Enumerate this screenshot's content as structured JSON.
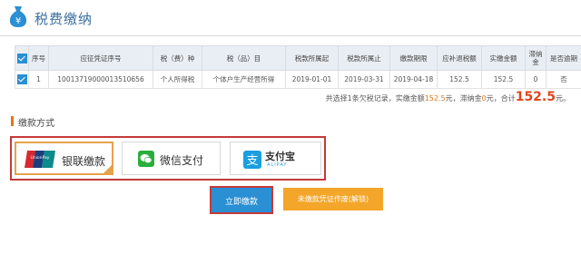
{
  "header": {
    "title": "税费缴纳"
  },
  "table": {
    "columns": [
      "序号",
      "应征凭证序号",
      "税（费）种",
      "税（品）目",
      "税款所属起",
      "税款所属止",
      "缴款期限",
      "应补退税额",
      "实缴金额",
      "滞纳金",
      "是否逾期"
    ],
    "rows": [
      [
        "1",
        "10013719000013510656",
        "个人所得税",
        "个体户生产经营所得",
        "2019-01-01",
        "2019-03-31",
        "2019-04-18",
        "152.5",
        "152.5",
        "0",
        "否"
      ]
    ]
  },
  "summary": {
    "prefix": "共选择1条欠税记录，实缴金额",
    "amount": "152.5",
    "mid1": "元，滞纳金",
    "late_fee": "0",
    "mid2": "元，合计",
    "total": "152.5",
    "suffix": "元。"
  },
  "payment_section": {
    "title": "缴款方式",
    "methods": [
      {
        "label": "银联缴款",
        "icon": "unionpay-icon",
        "selected": true,
        "logo_text": "UnionPay"
      },
      {
        "label": "微信支付",
        "icon": "wechat-icon",
        "selected": false
      },
      {
        "label": "支付宝",
        "sub": "ALIPAY",
        "icon": "alipay-icon",
        "selected": false
      }
    ]
  },
  "buttons": {
    "pay_now": "立即缴款",
    "certificate": "未缴款凭证作废(解锁)"
  },
  "colors": {
    "accent_blue": "#2a8fd3",
    "highlight_red": "#c43a3a",
    "orange": "#f3a629",
    "total_red": "#e2461a"
  }
}
